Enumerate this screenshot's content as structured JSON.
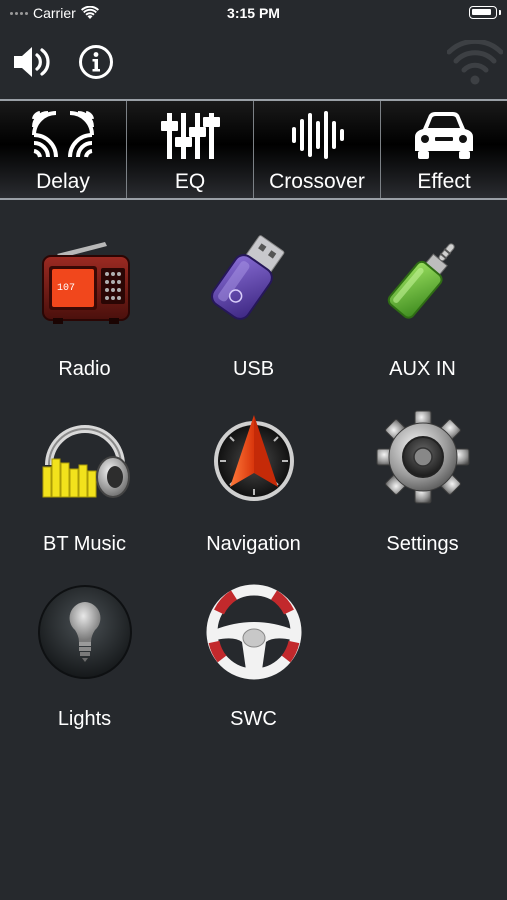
{
  "status_bar": {
    "carrier": "Carrier",
    "time": "3:15 PM"
  },
  "top_controls": {
    "volume_icon": "speaker-volume-icon",
    "info_icon": "info-circle-icon",
    "connection_icon": "wifi-signal-icon"
  },
  "tabs": [
    {
      "label": "Delay",
      "icon": "delay-waves-icon"
    },
    {
      "label": "EQ",
      "icon": "equalizer-sliders-icon"
    },
    {
      "label": "Crossover",
      "icon": "crossover-bars-icon"
    },
    {
      "label": "Effect",
      "icon": "car-icon"
    }
  ],
  "grid": [
    {
      "label": "Radio",
      "icon": "radio-icon"
    },
    {
      "label": "USB",
      "icon": "usb-drive-icon"
    },
    {
      "label": "AUX IN",
      "icon": "aux-jack-icon"
    },
    {
      "label": "BT Music",
      "icon": "headphones-icon"
    },
    {
      "label": "Navigation",
      "icon": "navigation-compass-icon"
    },
    {
      "label": "Settings",
      "icon": "gear-icon"
    },
    {
      "label": "Lights",
      "icon": "light-bulb-icon"
    },
    {
      "label": "SWC",
      "icon": "steering-wheel-icon"
    }
  ],
  "radio_display": "107",
  "colors": {
    "background": "#26292d",
    "radio_display": "#f1471c",
    "aux_green": "#6cbf3a",
    "usb_purple": "#5b3fa6",
    "nav_arrow": "#ff5a1e",
    "swc_red": "#c2292c"
  }
}
